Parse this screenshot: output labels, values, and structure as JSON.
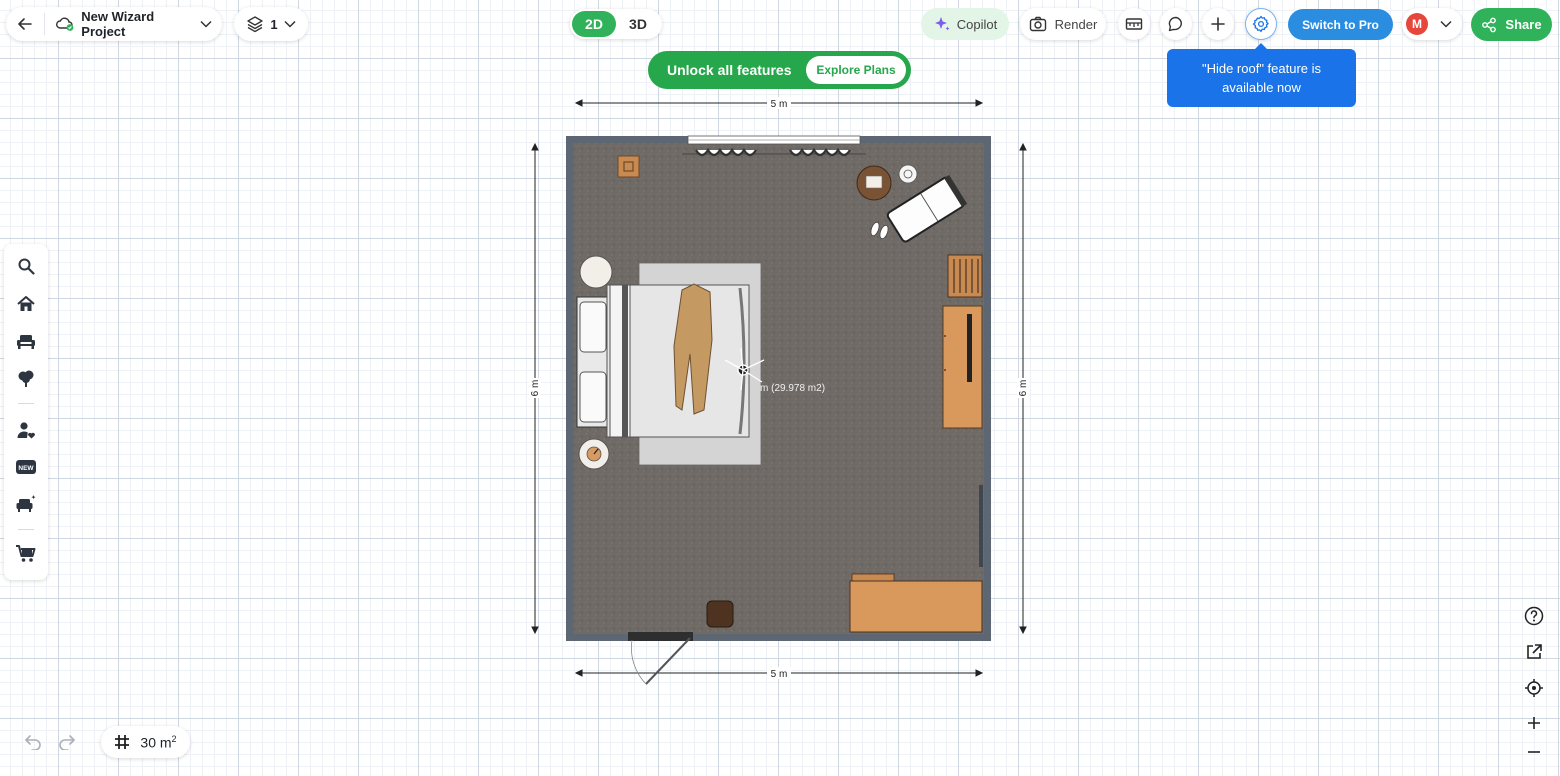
{
  "header": {
    "project_name": "New Wizard Project",
    "level": "1",
    "view_2d": "2D",
    "view_3d": "3D",
    "copilot_label": "Copilot",
    "render_label": "Render",
    "switch_pro_label": "Switch to Pro",
    "avatar_initial": "M",
    "share_label": "Share"
  },
  "promo": {
    "text": "Unlock all features",
    "button": "Explore Plans"
  },
  "tooltip": {
    "text": "\"Hide roof\" feature is available now"
  },
  "plan": {
    "dim_top": "5 m",
    "dim_bottom": "5 m",
    "dim_left": "6 m",
    "dim_right": "6 m",
    "room_label": "m (29.978 m2)"
  },
  "footer": {
    "area_value": "30 m",
    "area_unit_sup": "2"
  },
  "sidebar": {
    "items": [
      "search-icon",
      "home-icon",
      "sofa-icon",
      "tree-icon",
      "user-heart-icon",
      "new-badge-icon",
      "armchair-sparkle-icon",
      "cart-icon"
    ]
  },
  "colors": {
    "accent_green": "#2fb25a",
    "pro_blue": "#2a8de0",
    "tooltip_blue": "#1a73e8",
    "avatar_red": "#e5473d"
  }
}
